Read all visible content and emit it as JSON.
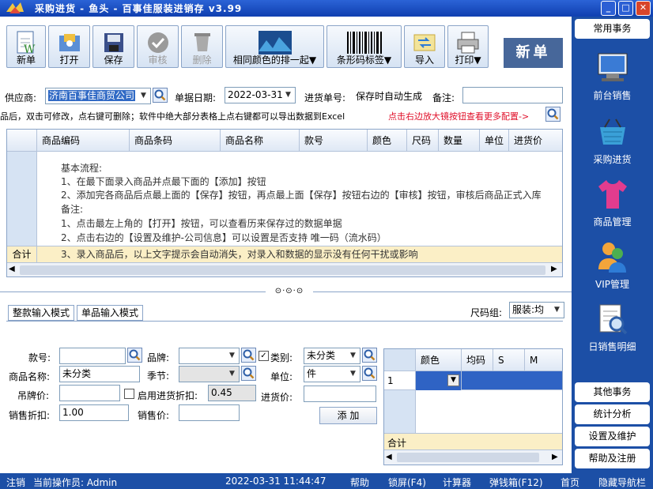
{
  "window": {
    "title": "采购进货 - 鱼头 - 百事佳服装进销存 v3.99",
    "min": "_",
    "max": "□",
    "close": "✕"
  },
  "toolbar": {
    "new": "新单",
    "open": "打开",
    "save": "保存",
    "audit": "审核",
    "delete": "删除",
    "same_color": "相同颜色的排一起▼",
    "barcode": "条形码标签▼",
    "import": "导入",
    "print": "打印▼",
    "new_single": "新单"
  },
  "sidebar": {
    "top_tab": "常用事务",
    "items": [
      {
        "label": "前台销售",
        "icon": "monitor-icon"
      },
      {
        "label": "采购进货",
        "icon": "basket-icon"
      },
      {
        "label": "商品管理",
        "icon": "tshirt-icon"
      },
      {
        "label": "VIP管理",
        "icon": "users-icon"
      },
      {
        "label": "日销售明细",
        "icon": "report-search-icon"
      }
    ],
    "bottom_tabs": [
      "其他事务",
      "统计分析",
      "设置及维护",
      "帮助及注册"
    ]
  },
  "form": {
    "supplier_label": "供应商:",
    "supplier_value": "济南百事佳商贸公司",
    "date_label": "单据日期:",
    "date_value": "2022-03-31",
    "order_no_label": "进货单号:",
    "order_no_value": "保存时自动生成",
    "remark_label": "备注:",
    "remark_value": "",
    "hint_black": "品后，双击可修改，点右键可删除；软件中绝大部分表格上点右键都可以导出数据到Excel",
    "hint_red": "点击右边放大镜按钮查看更多配置->"
  },
  "main_grid": {
    "columns": [
      "商品编码",
      "商品条码",
      "商品名称",
      "款号",
      "颜色",
      "尺码",
      "数量",
      "单位",
      "进货价"
    ],
    "footer_label": "合计",
    "notes": [
      "基本流程:",
      "1、在最下面录入商品并点最下面的【添加】按钮",
      "2、添加完各商品后点最上面的【保存】按钮，再点最上面【保存】按钮右边的【审核】按钮，审核后商品正式入库",
      "备注:",
      "1、点击最左上角的【打开】按钮，可以查看历来保存过的数据单据",
      "2、点击右边的【设置及维护-公司信息】可以设置是否支持  唯一码（流水码）",
      "3、录入商品后，以上文字提示会自动消失，对录入和数据的显示没有任何干扰或影响"
    ]
  },
  "input_area": {
    "tab_whole": "整款输入模式",
    "tab_single": "单品输入模式",
    "size_group_label": "尺码组:",
    "size_group_value": "服装:均",
    "style_no_label": "款号:",
    "brand_label": "品牌:",
    "category_label": "类别:",
    "category_value": "未分类",
    "product_name_label": "商品名称:",
    "product_name_value": "未分类",
    "season_label": "季节:",
    "unit_label": "单位:",
    "unit_value": "件",
    "tag_price_label": "吊牌价:",
    "enable_discount_label": "启用进货折扣:",
    "discount_value": "0.45",
    "purchase_price_label": "进货价:",
    "sale_discount_label": "销售折扣:",
    "sale_discount_value": "1.00",
    "sale_price_label": "销售价:",
    "add_button": "添 加",
    "category_checked": "✓"
  },
  "size_grid": {
    "columns": [
      "颜色",
      "均码",
      "S",
      "M"
    ],
    "row_no": "1",
    "footer_label": "合计"
  },
  "statusbar": {
    "logout": "注销",
    "operator": "当前操作员: Admin",
    "datetime": "2022-03-31 11:44:47",
    "help": "帮助",
    "lock": "锁屏(F4)",
    "calc": "计算器",
    "cashbox": "弹钱箱(F12)",
    "home": "首页",
    "hide_nav": "隐藏导航栏"
  }
}
